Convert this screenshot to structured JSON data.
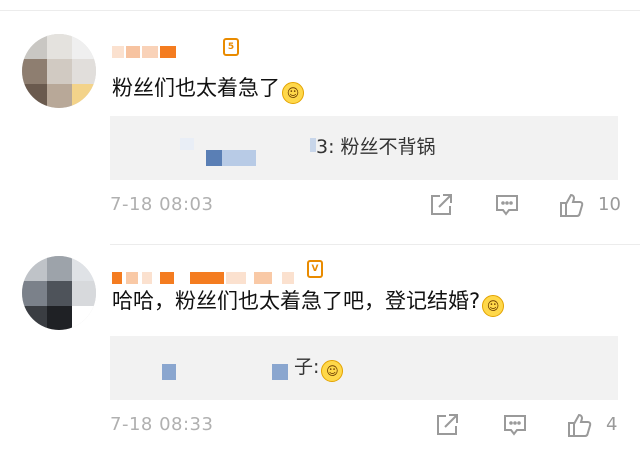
{
  "comments": [
    {
      "text": "粉丝们也太着急了",
      "quote": {
        "text": "3: 粉丝不背锅"
      },
      "timestamp": "7-18 08:03",
      "likes": "10",
      "badge_icon": "vip-badge-icon",
      "colors": {
        "name_blocks": "#f47c20"
      }
    },
    {
      "text": "哈哈，粉丝们也太着急了吧，登记结婚?",
      "quote": {
        "text": "子:"
      },
      "timestamp": "7-18 08:33",
      "likes": "4",
      "badge_icon": "vip-badge-icon",
      "colors": {
        "name_blocks": "#f47c20"
      }
    }
  ],
  "icons": {
    "share": "share-icon",
    "comment": "comment-icon",
    "like": "thumbs-up-icon",
    "emoji": "laughing-emoji-icon"
  },
  "colors": {
    "quote_background": "#f2f2f2",
    "timestamp": "#b0b0b0",
    "action_icon": "#9a9a9a",
    "badge": "#e98b00"
  }
}
